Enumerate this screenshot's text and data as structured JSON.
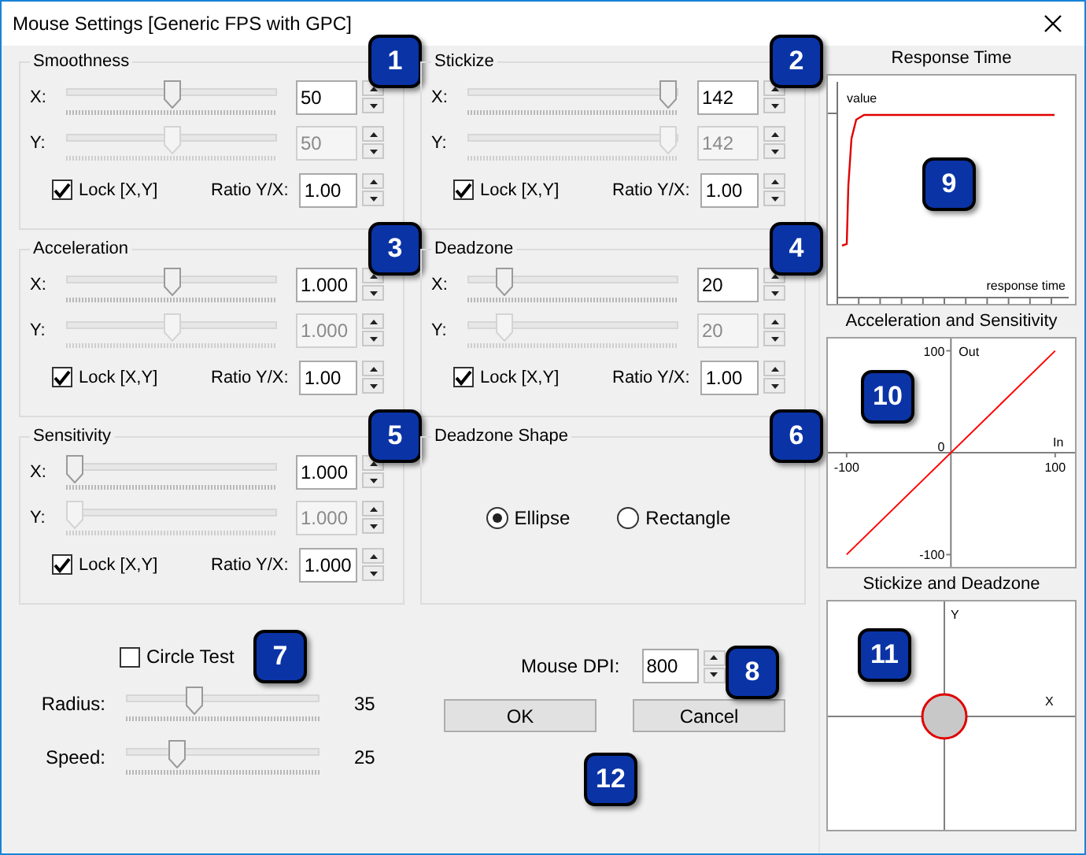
{
  "window": {
    "title": "Mouse Settings [Generic FPS with GPC]"
  },
  "groups": [
    {
      "title": "Smoothness",
      "badge": "1",
      "kind": "axes",
      "rows": [
        {
          "label": "X:",
          "level": 0.5,
          "value": "50",
          "disabled": false
        },
        {
          "label": "Y:",
          "level": 0.5,
          "value": "50",
          "disabled": true
        }
      ],
      "lock": {
        "label": "Lock [X,Y]",
        "checked": true
      },
      "ratio": {
        "label": "Ratio Y/X:",
        "value": "1.00"
      }
    },
    {
      "title": "Stickize",
      "badge": "2",
      "kind": "axes",
      "rows": [
        {
          "label": "X:",
          "level": 0.99,
          "value": "142",
          "disabled": false
        },
        {
          "label": "Y:",
          "level": 0.99,
          "value": "142",
          "disabled": true
        }
      ],
      "lock": {
        "label": "Lock [X,Y]",
        "checked": true
      },
      "ratio": {
        "label": "Ratio Y/X:",
        "value": "1.00"
      }
    },
    {
      "title": "Acceleration",
      "badge": "3",
      "kind": "axes",
      "rows": [
        {
          "label": "X:",
          "level": 0.5,
          "value": "1.000",
          "disabled": false
        },
        {
          "label": "Y:",
          "level": 0.5,
          "value": "1.000",
          "disabled": true
        }
      ],
      "lock": {
        "label": "Lock [X,Y]",
        "checked": true
      },
      "ratio": {
        "label": "Ratio Y/X:",
        "value": "1.00"
      }
    },
    {
      "title": "Deadzone",
      "badge": "4",
      "kind": "axes",
      "rows": [
        {
          "label": "X:",
          "level": 0.15,
          "value": "20",
          "disabled": false
        },
        {
          "label": "Y:",
          "level": 0.15,
          "value": "20",
          "disabled": true
        }
      ],
      "lock": {
        "label": "Lock [X,Y]",
        "checked": true
      },
      "ratio": {
        "label": "Ratio Y/X:",
        "value": "1.00"
      }
    },
    {
      "title": "Sensitivity",
      "badge": "5",
      "kind": "axes",
      "rows": [
        {
          "label": "X:",
          "level": 0,
          "value": "1.000",
          "disabled": false
        },
        {
          "label": "Y:",
          "level": 0,
          "value": "1.000",
          "disabled": true
        }
      ],
      "lock": {
        "label": "Lock [X,Y]",
        "checked": true
      },
      "ratio": {
        "label": "Ratio Y/X:",
        "value": "1.000"
      }
    },
    {
      "title": "Deadzone Shape",
      "badge": "6",
      "kind": "shape",
      "options": [
        {
          "label": "Ellipse",
          "selected": true
        },
        {
          "label": "Rectangle",
          "selected": false
        }
      ]
    }
  ],
  "circle_test": {
    "label": "Circle Test",
    "checked": false,
    "badge": "7"
  },
  "sliders": [
    {
      "label": "Radius:",
      "level": 0.34,
      "value": "35"
    },
    {
      "label": "Speed:",
      "level": 0.24,
      "value": "25"
    }
  ],
  "dpi": {
    "label": "Mouse DPI:",
    "value": "800",
    "badge": "8"
  },
  "buttons": [
    {
      "label": "OK"
    },
    {
      "label": "Cancel"
    }
  ],
  "buttons_badge": "12",
  "response_time": {
    "title": "Response Time",
    "badge": "9",
    "y_caption": "value",
    "x_caption": "response time"
  },
  "accel_chart": {
    "badge": "10",
    "chart_data": {
      "type": "line",
      "title": "Acceleration and Sensitivity",
      "xlabel": "In",
      "ylabel": "Out",
      "x": [
        -100,
        100
      ],
      "series": [
        {
          "color": "#ff0000",
          "values": [
            -100,
            100
          ]
        }
      ],
      "xlim": [
        -118,
        119
      ],
      "ylim": [
        -112,
        112
      ],
      "xticks": [
        -100,
        100
      ],
      "yticks": [
        -100,
        0,
        100
      ]
    }
  },
  "stick_chart": {
    "title": "Stickize and Deadzone",
    "badge": "11",
    "x_caption": "X",
    "y_caption": "Y"
  }
}
